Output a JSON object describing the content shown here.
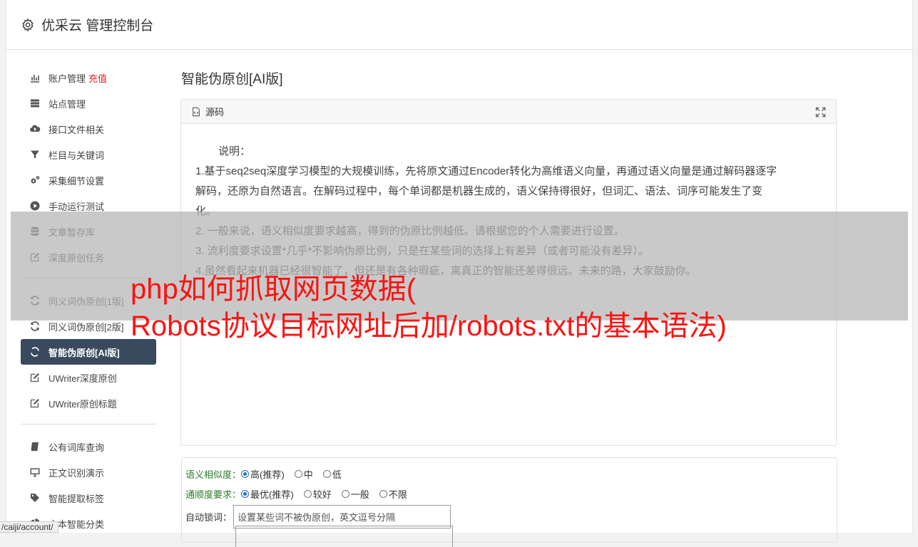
{
  "header": {
    "title": "优采云 管理控制台"
  },
  "sidebar": {
    "group1": [
      {
        "label": "账户管理",
        "extra": "充值",
        "icon": "bar-chart-icon"
      },
      {
        "label": "站点管理",
        "icon": "server-icon"
      },
      {
        "label": "接口文件相关",
        "icon": "cloud-upload-icon"
      },
      {
        "label": "栏目与关键词",
        "icon": "filter-icon"
      },
      {
        "label": "采集细节设置",
        "icon": "cogs-icon"
      },
      {
        "label": "手动运行测试",
        "icon": "play-circle-icon"
      },
      {
        "label": "文章暂存库",
        "icon": "database-icon"
      },
      {
        "label": "深度原创任务",
        "icon": "edit-icon"
      }
    ],
    "group2": [
      {
        "label": "同义词伪原创[1版]",
        "icon": "refresh-icon"
      },
      {
        "label": "同义词伪原创[2版]",
        "icon": "refresh-icon"
      },
      {
        "label": "智能伪原创[AI版]",
        "icon": "refresh-icon",
        "active": true
      },
      {
        "label": "UWriter深度原创",
        "icon": "edit-icon"
      },
      {
        "label": "UWriter原创标题",
        "icon": "edit-icon"
      }
    ],
    "group3": [
      {
        "label": "公有词库查询",
        "icon": "book-icon"
      },
      {
        "label": "正文识别演示",
        "icon": "monitor-icon"
      },
      {
        "label": "智能提取标签",
        "icon": "tag-icon"
      },
      {
        "label": "文本智能分类",
        "icon": "pie-chart-icon"
      }
    ]
  },
  "main": {
    "title": "智能伪原创[AI版]",
    "panel": {
      "head_label": "源码",
      "lines": [
        "说明：",
        "1.基于seq2seq深度学习模型的大规模训练，先将原文通过Encoder转化为高维语义向量，再通过语义向量是通过解码器逐字",
        "解码，还原为自然语言。在解码过程中，每个单词都是机器生成的，语义保持得很好，但词汇、语法、词序可能发生了变",
        "化。",
        "2. 一般来说，语义相似度要求越高，得到的伪原比例越低。请根据您的个人需要进行设置。",
        "3. 流利度要求设置*几乎*不影响伪原比例，只是在某些词的选择上有差异（或者可能没有差异）。",
        "4.虽然看起来机器已经很智能了，但还是有各种瑕疵，离真正的智能还差得很远。未来的路，大家鼓励你。"
      ]
    },
    "form": {
      "similarity_label": "语义相似度：",
      "similarity_options": [
        "高(推荐)",
        "中",
        "低"
      ],
      "fluency_label": "通顺度要求：",
      "fluency_options": [
        "最优(推荐)",
        "较好",
        "一般",
        "不限"
      ],
      "lock_label": "自动锁词：",
      "lock_placeholder": "设置某些词不被伪原创，英文逗号分隔"
    }
  },
  "overlay": {
    "line1": "php如何抓取网页数据(",
    "line2": "Robots协议目标网址后加/robots.txt的基本语法)"
  },
  "status_url": "/caiji/account/"
}
